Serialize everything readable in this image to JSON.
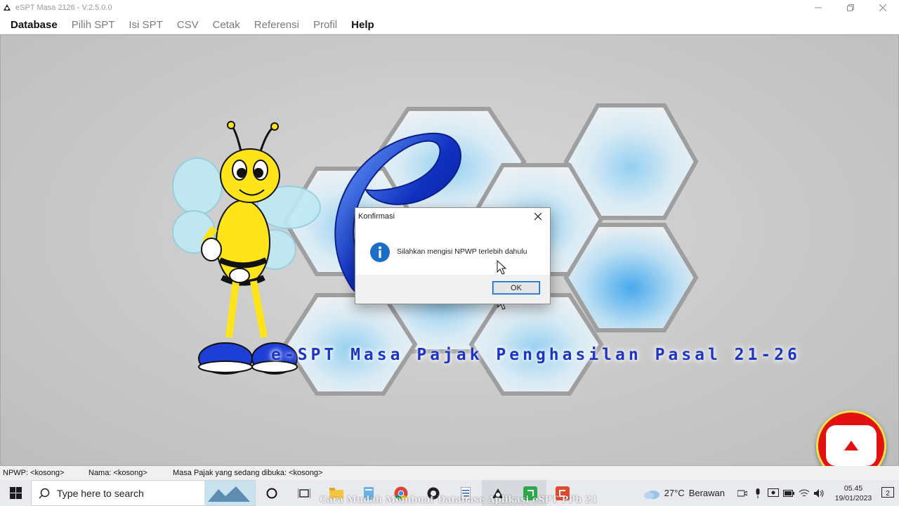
{
  "window": {
    "title": "eSPT Masa 2126 - V.2.5.0.0",
    "controls": [
      "minimize",
      "restore",
      "close"
    ]
  },
  "menu": {
    "items": [
      {
        "label": "Database",
        "active": true
      },
      {
        "label": "Pilih SPT",
        "active": false
      },
      {
        "label": "Isi SPT",
        "active": false
      },
      {
        "label": "CSV",
        "active": false
      },
      {
        "label": "Cetak",
        "active": false
      },
      {
        "label": "Referensi",
        "active": false
      },
      {
        "label": "Profil",
        "active": false
      },
      {
        "label": "Help",
        "active": true
      }
    ]
  },
  "splash": {
    "caption": "e-SPT Masa Pajak Penghasilan Pasal 21-26",
    "logo_text": "eSPT"
  },
  "dialog": {
    "title": "Konfirmasi",
    "message": "Silahkan mengisi NPWP terlebih dahulu",
    "ok_label": "OK",
    "icon": "info-icon"
  },
  "statusbar": {
    "npwp": "NPWP: <kosong>",
    "nama": "Nama: <kosong>",
    "masa": "Masa Pajak yang sedang dibuka: <kosong>"
  },
  "taskbar": {
    "search_placeholder": "Type here to search",
    "weather_temp": "27°C",
    "weather_desc": "Berawan",
    "time": "05.45",
    "date": "19/01/2023",
    "notification_count": "2",
    "overlay_caption": "Cara Mudah Membuat Database Aplikasi eSPT PPh 21"
  },
  "colors": {
    "accent_blue": "#1e35c4",
    "record_red": "#e21212",
    "dialog_focus": "#0a64c8"
  }
}
